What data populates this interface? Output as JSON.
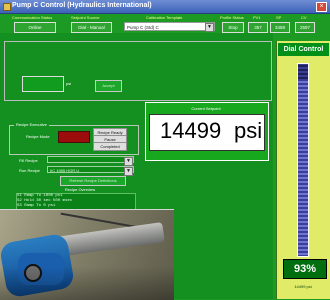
{
  "window": {
    "title": "Pump C Control (Hydraulics International)"
  },
  "header": {
    "communication_status_label": "Communication Status",
    "communication_status_value": "Online",
    "setpoint_source_label": "Setpoint Source",
    "setpoint_source_value": "Dial - Manual",
    "calibration_template_label": "Calibration Template",
    "calibration_template_value": "Pump C (Std) C",
    "profile_status_label": "Profile Status",
    "profile_status_value": "Stop",
    "pv_label": "PV1",
    "pv_value": "357",
    "sp_label": "SP",
    "sp_value": "3459",
    "cv_label": "CV",
    "cv_value": "2597"
  },
  "main": {
    "psi_small_label": "psi",
    "setpoint_title": "Current Setpoint",
    "setpoint_value": "14499",
    "setpoint_unit": "psi",
    "recipe": {
      "title": "Recipe Executive",
      "mode_label": "Recipe Mode",
      "ready_label": "Recipe Ready",
      "pause_label": "Pause",
      "completed_label": "Completed"
    },
    "fill_recipe_label": "Fill Recipe",
    "run_recipe_label": "Run Recipe",
    "run_recipe_value": "IIC 1985 HGR U",
    "refresh_button_label": "Refresh Recipe Definitions",
    "recipe_overview_label": "Recipe Overview",
    "recipe_lines": [
      "S1  Ramp To  1000  psi",
      "S2  Hold     30    sec      500  msec",
      "S3  Ramp To  0     psi"
    ]
  },
  "dial": {
    "title": "Dial Control",
    "percent": "93%",
    "psi_text": "14499 psi",
    "percent_value": 0.93
  },
  "colors": {
    "background": "#1d9a24",
    "panel": "#139020",
    "dial_bg": "#e0ec67",
    "dial_track": "#3b3f94",
    "recipe_mode_red": "#9a0d0b"
  },
  "icons": [
    "app-icon",
    "close-icon",
    "chevron-down-icon"
  ]
}
